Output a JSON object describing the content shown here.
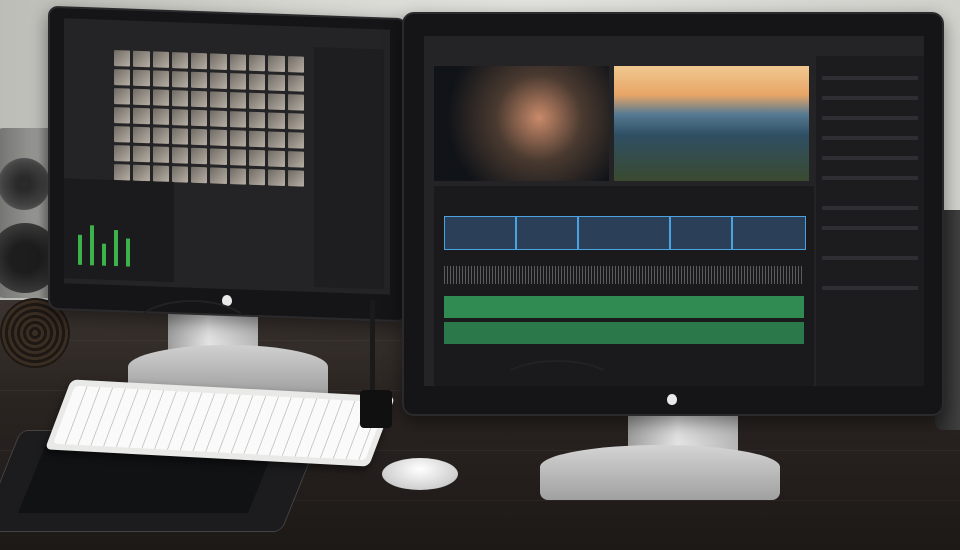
{
  "scene": {
    "description_free": true,
    "left_monitor": {
      "screen_app": "media-pool-and-fairlight",
      "brand_mark": "apple-logo-icon"
    },
    "right_monitor": {
      "screen_app": "edit-timeline",
      "brand_mark": "apple-logo-icon"
    }
  },
  "colors": {
    "wall": "#d6d6d1",
    "desk": "#2a2421",
    "monitor_bezel": "#151517",
    "stand_aluminum": "#d0d0d0",
    "audio_track": "#2f8b52",
    "video_track": "#2b4058"
  },
  "objects": [
    "speaker-left",
    "headphones",
    "monitor-left",
    "monitor-right",
    "keyboard",
    "mouse",
    "pen-tablet",
    "stylus-pen",
    "speaker-right"
  ]
}
